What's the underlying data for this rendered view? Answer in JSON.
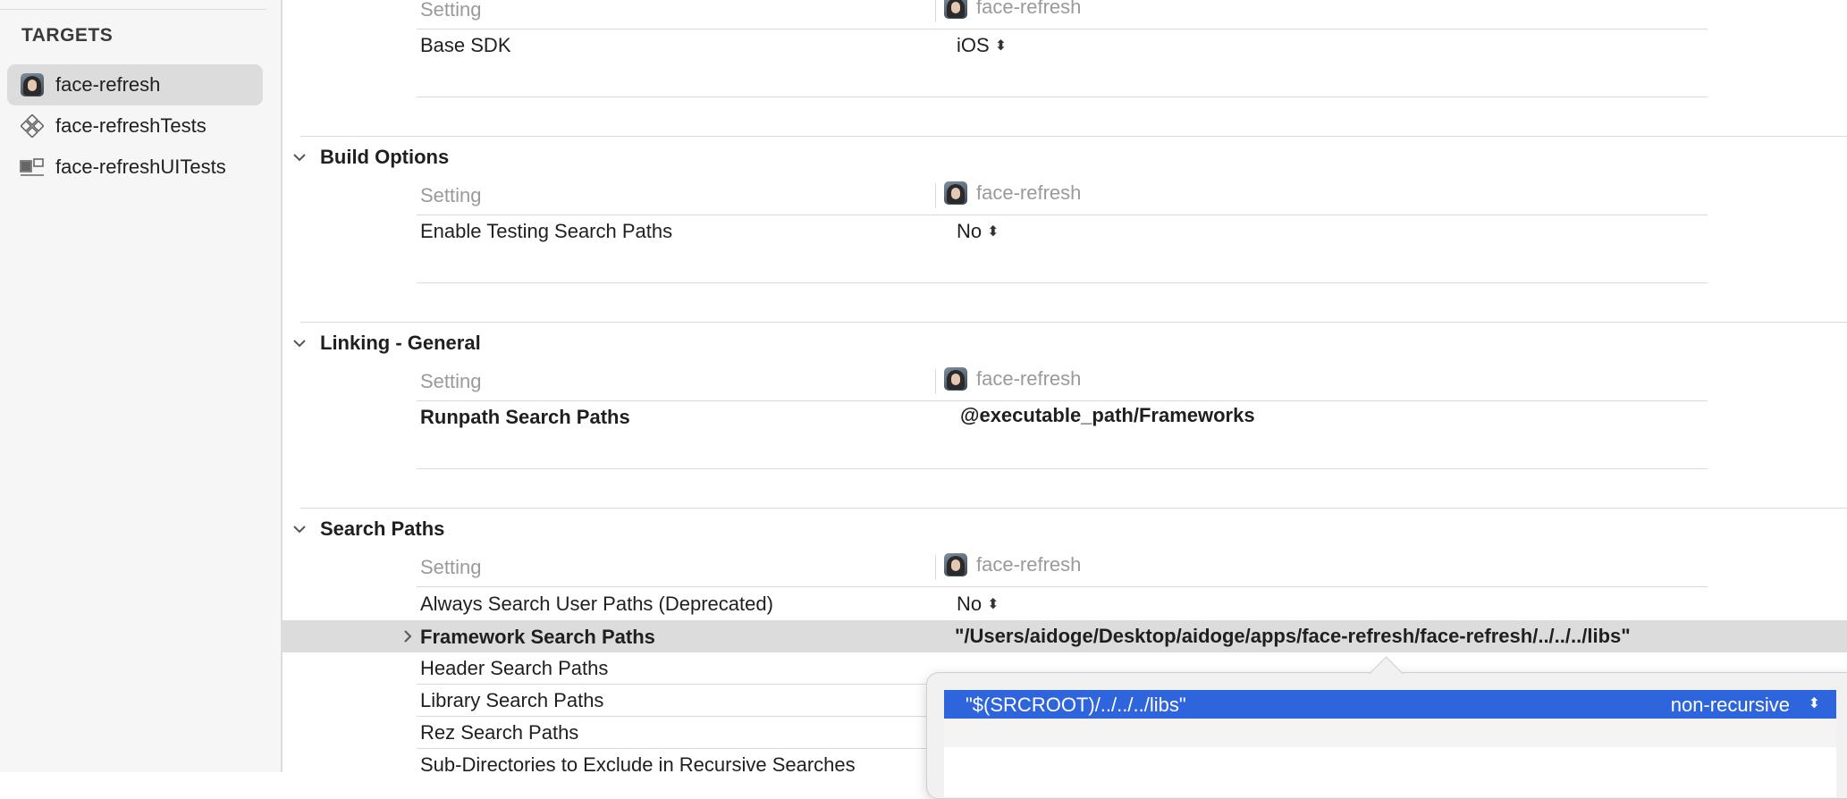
{
  "sidebar": {
    "header": "TARGETS",
    "items": [
      {
        "label": "face-refresh",
        "icon": "app-avatar-icon",
        "selected": true
      },
      {
        "label": "face-refreshTests",
        "icon": "unit-tests-icon",
        "selected": false
      },
      {
        "label": "face-refreshUITests",
        "icon": "ui-tests-icon",
        "selected": false
      }
    ]
  },
  "columns": {
    "setting": "Setting",
    "target": "face-refresh"
  },
  "top_section": {
    "rows": [
      {
        "name": "Base SDK",
        "value": "iOS"
      }
    ]
  },
  "sections": [
    {
      "title": "Build Options",
      "rows": [
        {
          "name": "Enable Testing Search Paths",
          "value": "No"
        }
      ]
    },
    {
      "title": "Linking - General",
      "rows": [
        {
          "name": "Runpath Search Paths",
          "value": "@executable_path/Frameworks"
        }
      ]
    },
    {
      "title": "Search Paths",
      "rows": [
        {
          "name": "Always Search User Paths (Deprecated)",
          "value": "No"
        },
        {
          "name": "Framework Search Paths",
          "value": "\"/Users/aidoge/Desktop/aidoge/apps/face-refresh/face-refresh/../../../libs\""
        },
        {
          "name": "Header Search Paths",
          "value": ""
        },
        {
          "name": "Library Search Paths",
          "value": ""
        },
        {
          "name": "Rez Search Paths",
          "value": ""
        },
        {
          "name": "Sub-Directories to Exclude in Recursive Searches",
          "value": ""
        }
      ]
    }
  ],
  "popover": {
    "items": [
      {
        "path": "\"$(SRCROOT)/../../../libs\"",
        "mode": "non-recursive"
      }
    ]
  },
  "colors": {
    "selection": "#2e64dc",
    "highlight_row": "#dcdcdc"
  }
}
